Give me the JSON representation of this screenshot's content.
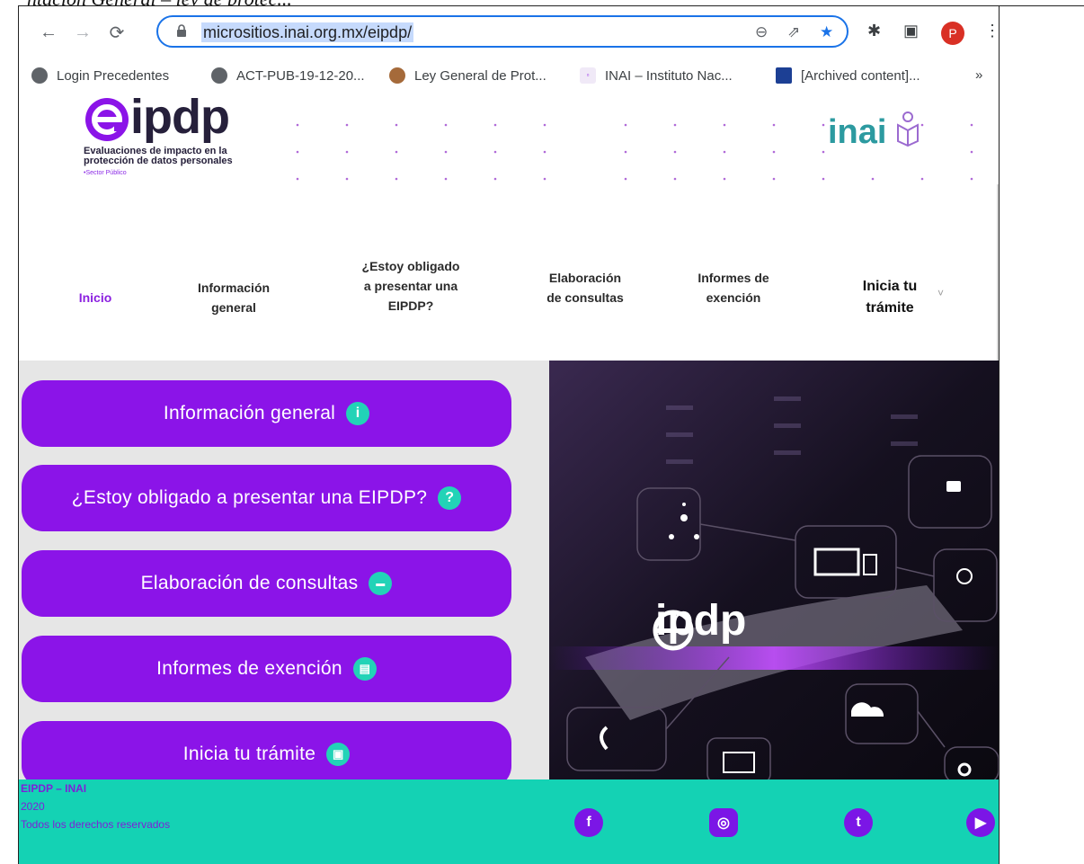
{
  "cropped_heading": "ntación General – ley de protec...",
  "browser": {
    "url": "micrositios.inai.org.mx/eipdp/",
    "profile_initial": "P",
    "bookmarks": [
      {
        "label": "Login Precedentes",
        "icon": "globe-icon"
      },
      {
        "label": "ACT-PUB-19-12-20...",
        "icon": "globe-icon"
      },
      {
        "label": "Ley General de Prot...",
        "icon": "seal-icon"
      },
      {
        "label": "INAI – Instituto Nac...",
        "icon": "inai-favicon"
      },
      {
        "label": "[Archived content]...",
        "icon": "eu-flag-icon"
      }
    ],
    "more_bookmarks": "»"
  },
  "header": {
    "logo_text": "ipdp",
    "logo_subtitle": "Evaluaciones de impacto en la protección de datos personales",
    "logo_tag": "•Sector Público",
    "inai_logo": "inai"
  },
  "nav": {
    "items": [
      {
        "label": "Inicio"
      },
      {
        "label": "Información general"
      },
      {
        "label": "¿Estoy obligado a presentar una EIPDP?"
      },
      {
        "label": "Elaboración de consultas"
      },
      {
        "label": "Informes de exención"
      },
      {
        "label": "Inicia tu trámite"
      }
    ],
    "chevron": "˅"
  },
  "menu": [
    {
      "label": "Información general",
      "icon": "info-icon",
      "glyph": "i"
    },
    {
      "label": "¿Estoy obligado a presentar una EIPDP?",
      "icon": "question-icon",
      "glyph": "?"
    },
    {
      "label": "Elaboración de consultas",
      "icon": "chat-icon",
      "glyph": "▬"
    },
    {
      "label": "Informes de exención",
      "icon": "document-icon",
      "glyph": "▤"
    },
    {
      "label": "Inicia tu trámite",
      "icon": "form-icon",
      "glyph": "▣"
    }
  ],
  "hero": {
    "brand": "ipdp"
  },
  "footer": {
    "line1": "EIPDP – INAI",
    "line2": "2020",
    "line3": "Todos los derechos reservados",
    "social": [
      {
        "name": "facebook-icon",
        "glyph": "f"
      },
      {
        "name": "instagram-icon",
        "glyph": "◎"
      },
      {
        "name": "twitter-icon",
        "glyph": "t"
      },
      {
        "name": "youtube-icon",
        "glyph": "▶"
      }
    ]
  },
  "colors": {
    "accent": "#8b14e8",
    "teal": "#14d2b4",
    "focus": "#1a73e8"
  }
}
